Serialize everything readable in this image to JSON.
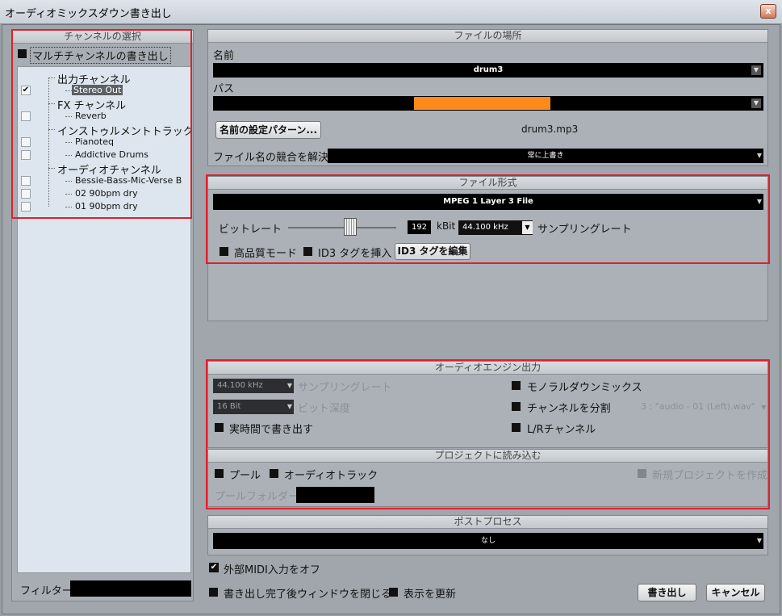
{
  "window": {
    "title": "オーディオミックスダウン書き出し",
    "close_label": "x"
  },
  "channels": {
    "header": "チャンネルの選択",
    "multichannel_label": "マルチチャンネルの書き出し",
    "groups": [
      {
        "label": "出力チャンネル",
        "items": [
          {
            "label": "Stereo Out",
            "checked": true,
            "selected": true
          }
        ]
      },
      {
        "label": "FX チャンネル",
        "items": [
          {
            "label": "Reverb",
            "checked": false
          }
        ]
      },
      {
        "label": "インストゥルメントトラック",
        "items": [
          {
            "label": "Pianoteq",
            "checked": false
          },
          {
            "label": "Addictive Drums",
            "checked": false
          }
        ]
      },
      {
        "label": "オーディオチャンネル",
        "items": [
          {
            "label": "Bessie-Bass-Mic-Verse B",
            "checked": false
          },
          {
            "label": "02 90bpm dry",
            "checked": false
          },
          {
            "label": "01 90bpm dry",
            "checked": false
          }
        ]
      }
    ],
    "filter_label": "フィルター",
    "checkmark": "✔"
  },
  "file_location": {
    "header": "ファイルの場所",
    "name_label": "名前",
    "name_value": "drum3",
    "path_label": "パス",
    "pattern_button": "名前の設定パターン...",
    "filename_preview": "drum3.mp3",
    "conflict_label": "ファイル名の競合を解決",
    "conflict_value": "常に上書き"
  },
  "file_format": {
    "header": "ファイル形式",
    "format_value": "MPEG 1 Layer 3 File",
    "bitrate_label": "ビットレート",
    "bitrate_value": "192",
    "bitrate_unit": "kBit",
    "samplerate_value": "44.100 kHz",
    "samplerate_label": "サンプリングレート",
    "hq_label": "高品質モード",
    "id3_insert_label": "ID3 タグを挿入",
    "id3_edit_button": "ID3 タグを編集"
  },
  "engine": {
    "header": "オーディオエンジン出力",
    "samplerate_value": "44.100 kHz",
    "samplerate_label": "サンプリングレート",
    "bitdepth_value": "16 Bit",
    "bitdepth_label": "ビット深度",
    "realtime_label": "実時間で書き出す",
    "mono_label": "モノラルダウンミックス",
    "split_label": "チャンネルを分割",
    "split_value": "3 : \"audio - 01 (Left).wav\"",
    "lr_label": "L/Rチャンネル"
  },
  "project_import": {
    "header": "プロジェクトに読み込む",
    "pool_label": "プール",
    "audio_track_label": "オーディオトラック",
    "new_project_label": "新規プロジェクトを作成",
    "pool_folder_label": "プールフォルダー"
  },
  "post_process": {
    "header": "ポストプロセス",
    "value": "なし"
  },
  "footer": {
    "midi_off_label": "外部MIDI入力をオフ",
    "close_after_label": "書き出し完了後ウィンドウを閉じる",
    "update_display_label": "表示を更新",
    "export_button": "書き出し",
    "cancel_button": "キャンセル"
  },
  "colors": {
    "highlight": "#e0202a",
    "path_progress": "#ff8a1c"
  }
}
